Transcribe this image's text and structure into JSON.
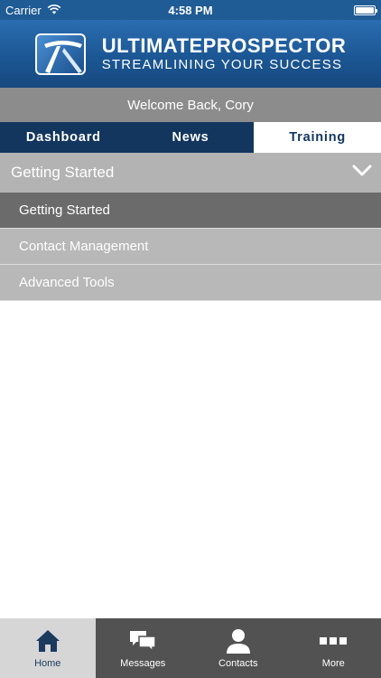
{
  "status_bar": {
    "carrier": "Carrier",
    "time": "4:58 PM",
    "icons": [
      "wifi-icon",
      "battery-icon"
    ]
  },
  "header": {
    "logo_line1": "ULTIMATEPROSPECTOR",
    "logo_line2": "STREAMLINING YOUR SUCCESS"
  },
  "welcome": {
    "text": "Welcome Back, Cory"
  },
  "tabs": [
    {
      "label": "Dashboard",
      "active": false
    },
    {
      "label": "News",
      "active": false
    },
    {
      "label": "Training",
      "active": true
    }
  ],
  "section": {
    "title": "Getting Started",
    "icon": "chevron-down-icon"
  },
  "list": [
    {
      "label": "Getting Started",
      "selected": true
    },
    {
      "label": "Contact Management",
      "selected": false
    },
    {
      "label": "Advanced Tools",
      "selected": false
    }
  ],
  "tabbar": [
    {
      "label": "Home",
      "icon": "home-icon",
      "active": true
    },
    {
      "label": "Messages",
      "icon": "messages-icon",
      "active": false
    },
    {
      "label": "Contacts",
      "icon": "contacts-icon",
      "active": false
    },
    {
      "label": "More",
      "icon": "more-icon",
      "active": false
    }
  ],
  "colors": {
    "brand_blue": "#1f5b95",
    "tab_navy": "#13365f",
    "selected_row": "#6b6b6b",
    "tabbar_bg": "#525252"
  }
}
